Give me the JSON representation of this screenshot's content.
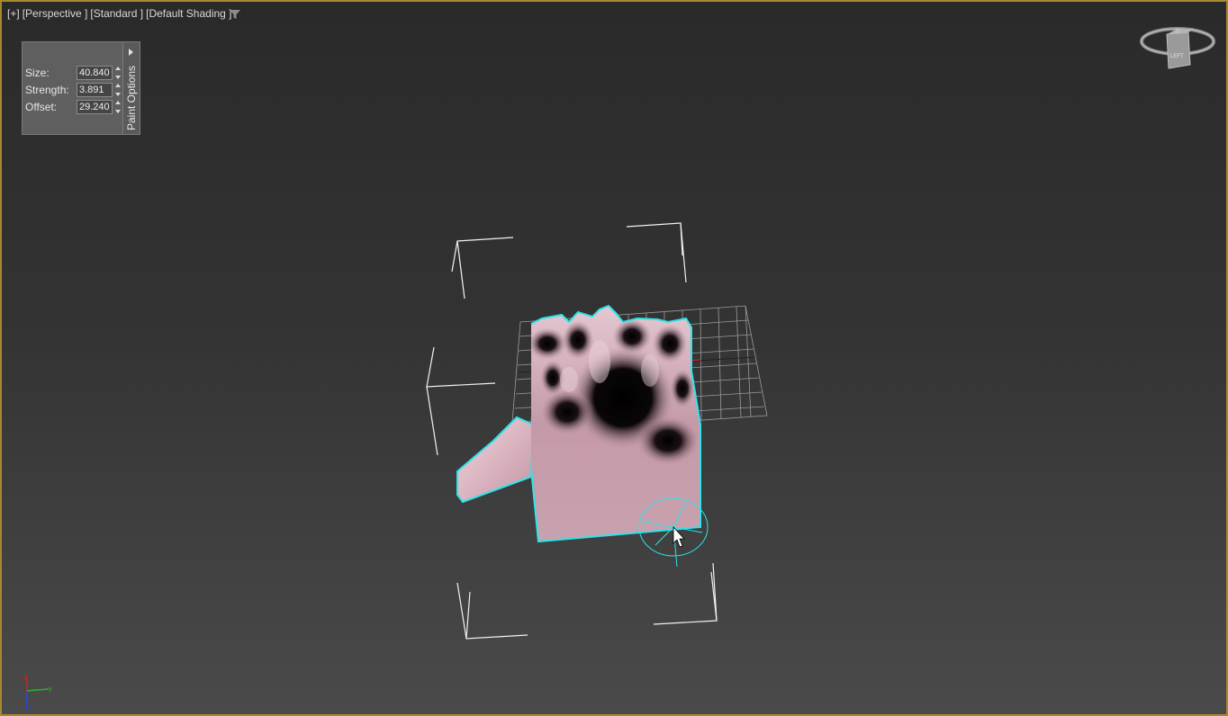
{
  "viewport": {
    "labels": {
      "plus": "[+]",
      "view": "[Perspective ]",
      "mode": "[Standard ]",
      "shading": "[Default Shading ]"
    },
    "border_color": "#a5892e"
  },
  "paint_options": {
    "tab_label": "Paint Options",
    "params": [
      {
        "label": "Size:",
        "value": "40.840"
      },
      {
        "label": "Strength:",
        "value": "3.891"
      },
      {
        "label": "Offset:",
        "value": "29.240"
      }
    ]
  },
  "viewcube": {
    "face_label": "LEFT",
    "compass": "N"
  },
  "axis_tripod": {
    "z": "z",
    "y": "y",
    "x": "x"
  },
  "colors": {
    "selection": "#2fe3e8",
    "mesh": "#c9a1ae",
    "x_axis": "#cc2222",
    "y_axis": "#22bb22",
    "z_axis": "#2244ff"
  },
  "icons": {
    "filter": "filter-icon",
    "brush": "paint-brush-icon",
    "cursor": "arrow-cursor-icon"
  }
}
